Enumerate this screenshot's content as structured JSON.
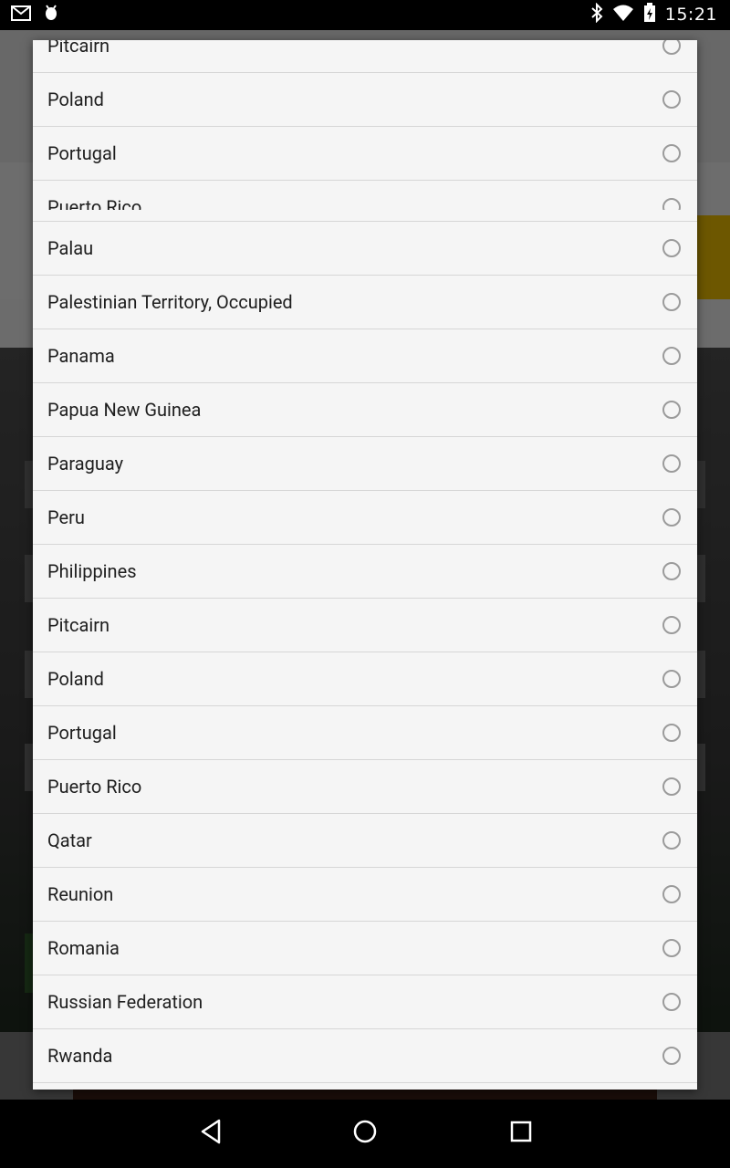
{
  "status_bar": {
    "time": "15:21",
    "left_icons": [
      "gmail-icon",
      "android-debug-icon"
    ],
    "right_icons": [
      "bluetooth-icon",
      "wifi-icon",
      "battery-charging-icon"
    ]
  },
  "dialog": {
    "ghost_items": [
      "Pitcairn",
      "Poland",
      "Portugal",
      "Puerto Rico"
    ],
    "items": [
      "Palau",
      "Palestinian Territory, Occupied",
      "Panama",
      "Papua New Guinea",
      "Paraguay",
      "Peru",
      "Philippines",
      "Pitcairn",
      "Poland",
      "Portugal",
      "Puerto Rico",
      "Qatar",
      "Reunion",
      "Romania",
      "Russian Federation",
      "Rwanda"
    ]
  },
  "nav_bar": {
    "buttons": [
      "back-icon",
      "home-icon",
      "recents-icon"
    ]
  },
  "colors": {
    "dialog_bg": "#f5f5f5",
    "divider": "#d6d6d6",
    "radio": "#9b9b9b",
    "text": "#1e1e1e"
  }
}
